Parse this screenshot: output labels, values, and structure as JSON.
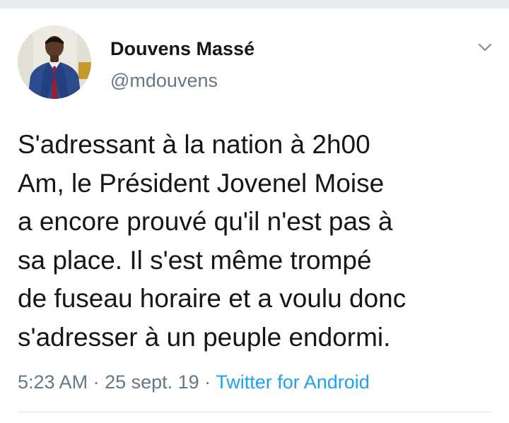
{
  "tweet": {
    "author": {
      "display_name": "Douvens Massé",
      "handle": "@mdouvens",
      "avatar_icon": "user-avatar-photo"
    },
    "text": "S'adressant à la nation à 2h00\nAm, le Président Jovenel Moise\na encore prouvé qu'il n'est pas à\nsa place. Il s'est même trompé\nde fuseau horaire et a voulu donc\ns'adresser à un peuple endormi.",
    "time": "5:23 AM",
    "separator_1": " · ",
    "date": "25 sept. 19",
    "separator_2": " · ",
    "source": "Twitter for Android",
    "more_icon": "chevron-down-icon"
  },
  "colors": {
    "primary_text": "#14171a",
    "secondary_text": "#657786",
    "link": "#1da1f2",
    "top_rule": "#e8edf1",
    "divider": "#dfe3e7"
  }
}
